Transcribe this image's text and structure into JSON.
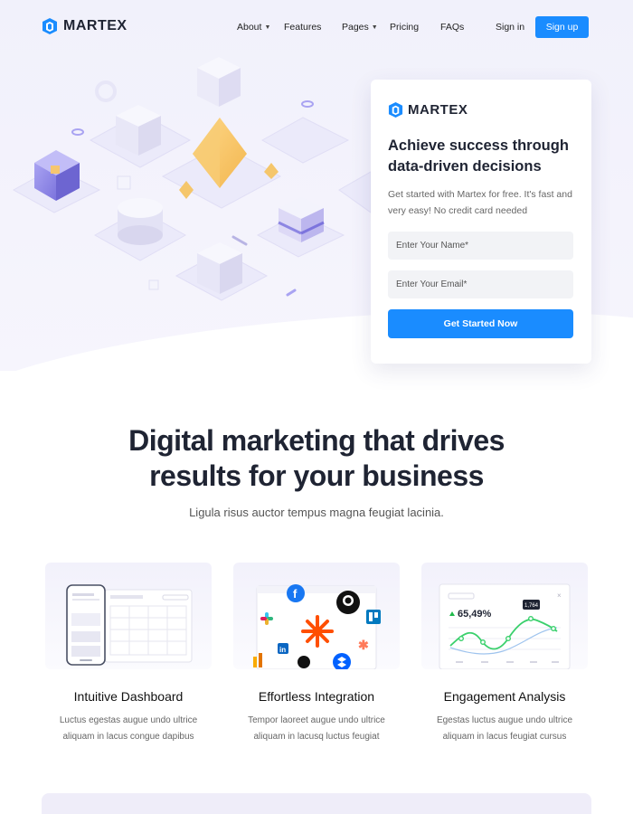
{
  "brand": {
    "name": "MARTEX",
    "accent": "#1a8cff"
  },
  "nav": {
    "about": "About",
    "features": "Features",
    "pages": "Pages",
    "pricing": "Pricing",
    "faqs": "FAQs",
    "signin": "Sign in",
    "signup": "Sign up"
  },
  "form": {
    "brand": "MARTEX",
    "title": "Achieve success through data-driven decisions",
    "subtitle": "Get started with Martex for free. It's fast and very easy! No credit card needed",
    "name_placeholder": "Enter Your Name*",
    "email_placeholder": "Enter Your Email*",
    "cta": "Get Started Now"
  },
  "section": {
    "title_line1": "Digital marketing that drives",
    "title_line2": "results for your business",
    "subtitle": "Ligula risus auctor tempus magna feugiat lacinia."
  },
  "features": [
    {
      "title": "Intuitive Dashboard",
      "desc_line1": "Luctus egestas augue undo ultrice",
      "desc_line2": "aliquam in lacus congue dapibus"
    },
    {
      "title": "Effortless Integration",
      "desc_line1": "Tempor laoreet augue undo ultrice",
      "desc_line2": "aliquam in lacusq luctus feugiat"
    },
    {
      "title": "Engagement Analysis",
      "desc_line1": "Egestas luctus augue undo ultrice",
      "desc_line2": "aliquam in lacus feugiat cursus"
    }
  ],
  "analytics": {
    "percent": "65,49%",
    "tooltip": "1,764"
  }
}
